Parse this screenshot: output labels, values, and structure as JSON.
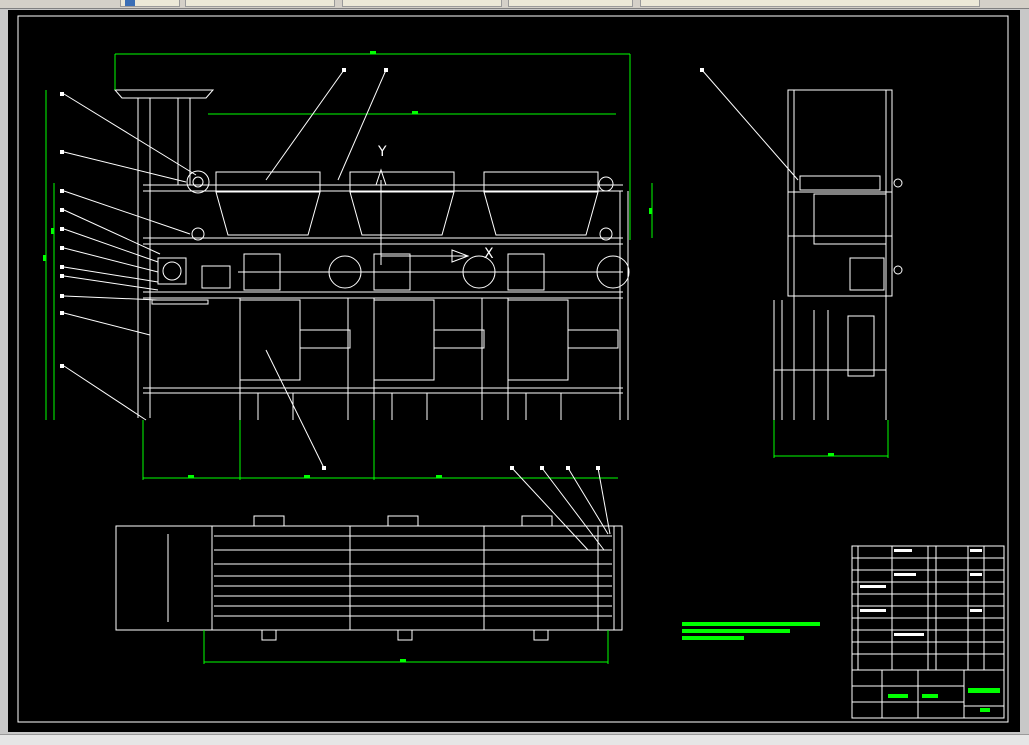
{
  "app": {
    "tabs": [
      "",
      "",
      "",
      "",
      ""
    ]
  },
  "drawing": {
    "axis_y": "Y",
    "axis_x": "X",
    "part_labels": [
      "",
      "",
      "",
      "",
      "",
      "",
      "",
      "",
      "",
      "",
      "",
      "",
      "",
      "",
      "",
      "",
      "",
      ""
    ],
    "tech_req_title": "",
    "title_block_name": "",
    "title_block_code": ""
  },
  "colors": {
    "background": "#000000",
    "lines": "#ffffff",
    "dimensions": "#00ff00"
  }
}
